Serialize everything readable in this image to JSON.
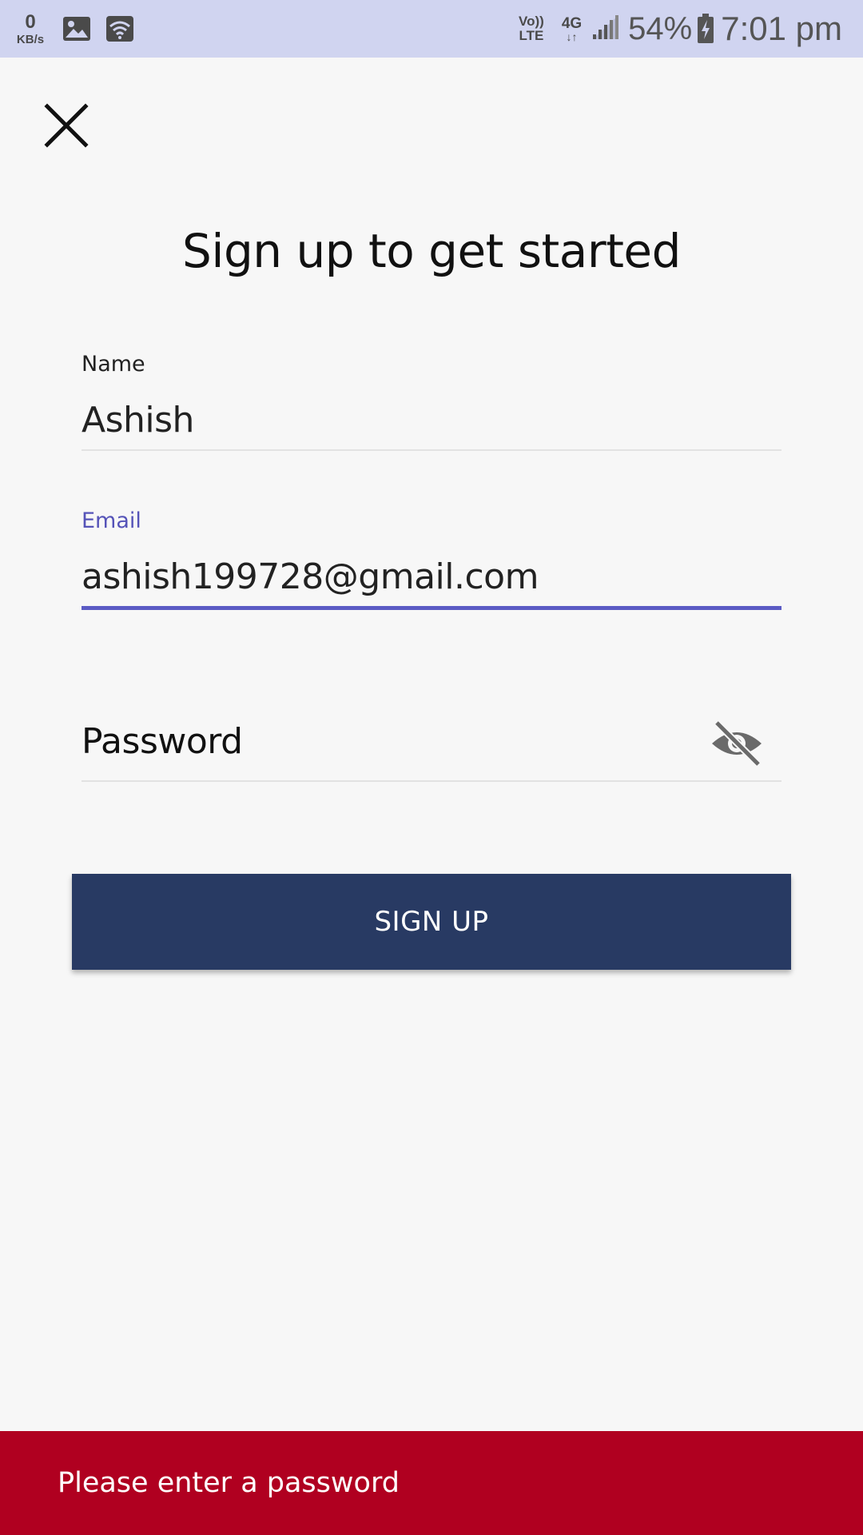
{
  "status_bar": {
    "net_speed_value": "0",
    "net_speed_unit": "KB/s",
    "volte_line1": "Vo))",
    "volte_line2": "LTE",
    "network_type": "4G",
    "network_arrows": "↓↑",
    "battery_percent": "54%",
    "time": "7:01 pm",
    "icons": [
      "gallery-icon",
      "wifi-icon",
      "signal-icon",
      "battery-charging-icon"
    ]
  },
  "header": {
    "close_icon": "close-icon",
    "title": "Sign up to get started"
  },
  "form": {
    "name": {
      "label": "Name",
      "value": "Ashish"
    },
    "email": {
      "label": "Email",
      "value": "ashish199728@gmail.com",
      "focused": true
    },
    "password": {
      "placeholder": "Password",
      "value": "",
      "toggle_icon": "eye-off-icon"
    },
    "submit_label": "SIGN UP"
  },
  "snackbar": {
    "message": "Please enter a password"
  },
  "colors": {
    "status_bar_bg": "#d0d4f0",
    "page_bg": "#f7f7f7",
    "accent": "#5b5bc4",
    "button_bg": "#283a63",
    "error_bg": "#b00020"
  }
}
